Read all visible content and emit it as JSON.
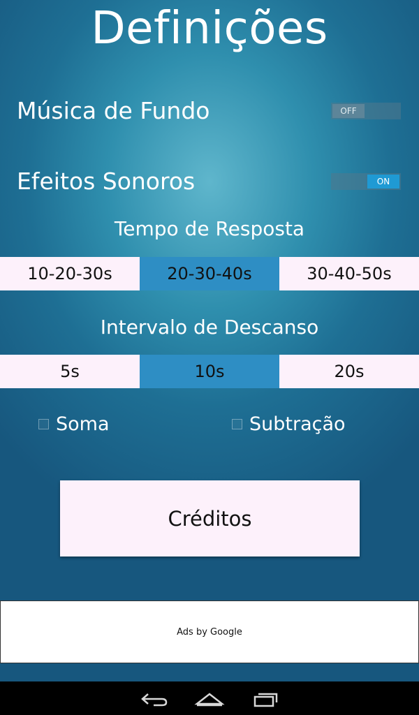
{
  "header": {
    "title": "Definições"
  },
  "settings": {
    "music": {
      "label": "Música de Fundo",
      "state": "OFF"
    },
    "effects": {
      "label": "Efeitos Sonoros",
      "state": "ON"
    }
  },
  "response_time": {
    "title": "Tempo de Resposta",
    "options": [
      "10-20-30s",
      "20-30-40s",
      "30-40-50s"
    ],
    "selected": "20-30-40s"
  },
  "rest_interval": {
    "title": "Intervalo de Descanso",
    "options": [
      "5s",
      "10s",
      "20s"
    ],
    "selected": "10s"
  },
  "operations": {
    "sum": {
      "label": "Soma",
      "checked": false
    },
    "subtraction": {
      "label": "Subtração",
      "checked": false
    }
  },
  "credits_button": {
    "label": "Créditos"
  },
  "ad": {
    "text": "Ads by Google"
  },
  "navbar": {
    "icons": [
      "back-icon",
      "home-icon",
      "recent-apps-icon"
    ]
  },
  "colors": {
    "segment_selected": "#2e8ec4",
    "segment_default": "#fdf1fb",
    "toggle_on": "#1f9ad4"
  }
}
